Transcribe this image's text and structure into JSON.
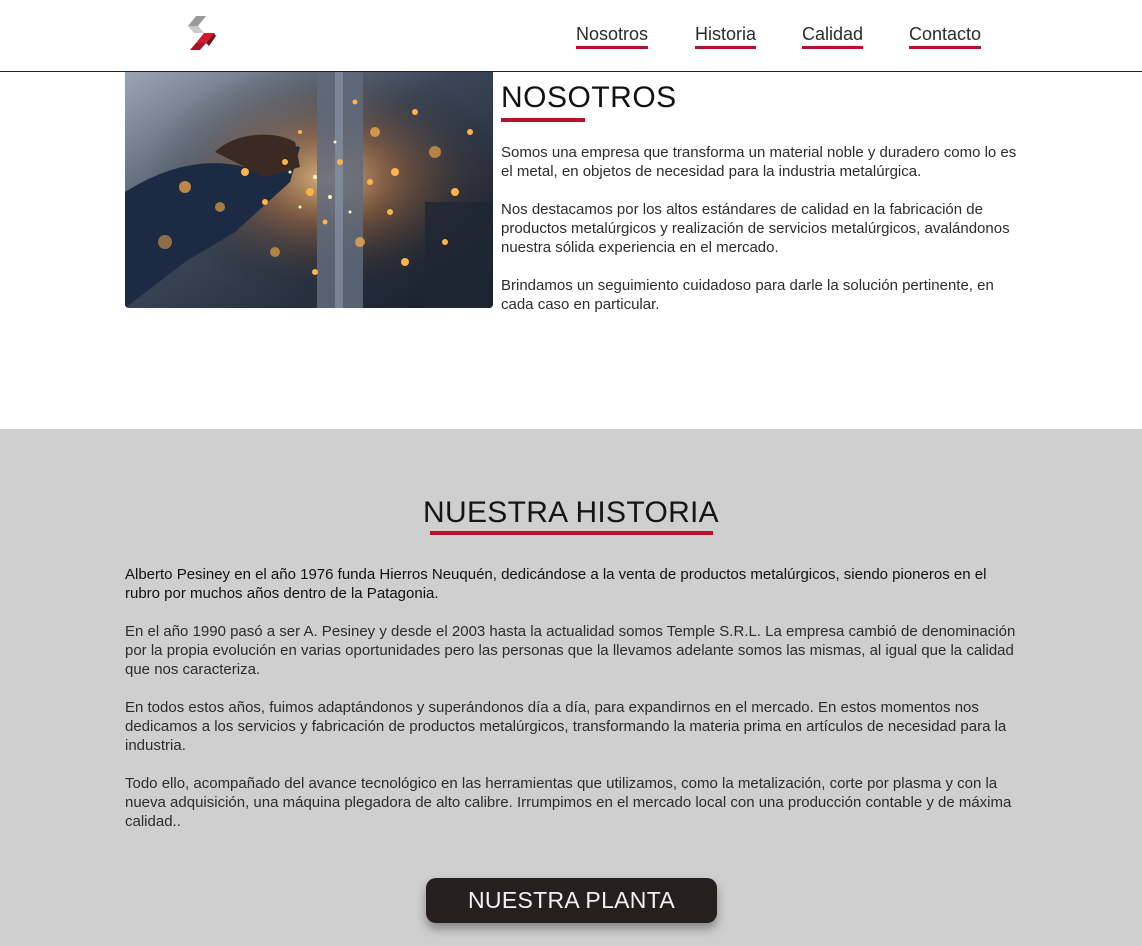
{
  "header": {
    "logo_icon": "temple-logo-icon",
    "nav": [
      {
        "label": "Nosotros"
      },
      {
        "label": "Historia"
      },
      {
        "label": "Calidad"
      },
      {
        "label": "Contacto"
      }
    ]
  },
  "about": {
    "image_icon": "welding-sparks-photo",
    "title": "NOSOTROS",
    "paragraphs": [
      "Somos una empresa que transforma un material noble y duradero como lo es el metal, en objetos de necesidad para la industria metalúrgica.",
      "Nos destacamos por los altos estándares de calidad en la fabricación de productos metalúrgicos y realización de servicios metalúrgicos, avalándonos nuestra sólida experiencia en el mercado.",
      "Brindamos un seguimiento cuidadoso para darle la solución pertinente, en cada caso en particular."
    ]
  },
  "history": {
    "title": "NUESTRA HISTORIA",
    "paragraphs": [
      "Alberto Pesiney en el año 1976 funda Hierros Neuquén, dedicándose a la venta de productos metalúrgicos, siendo pioneros en el rubro por muchos años dentro de la Patagonia.",
      "En el año 1990 pasó a ser A. Pesiney y desde el 2003 hasta la actualidad somos Temple S.R.L. La empresa cambió de denominación por la propia evolución en varias oportunidades pero las personas que la llevamos adelante somos las mismas, al igual que la calidad que nos caracteriza.",
      "En todos estos años, fuimos adaptándonos y superándonos día a día, para expandirnos en el mercado. En estos momentos nos dedicamos a los servicios y fabricación de productos metalúrgicos, transformando la materia prima en artículos de necesidad para la industria.",
      "Todo ello, acompañado del avance tecnológico en las herramientas que utilizamos, como la metalización, corte por plasma y con la nueva adquisición, una máquina plegadora de alto calibre. Irrumpimos en el mercado local con una producción contable y de máxima calidad.."
    ],
    "button_label": "NUESTRA PLANTA"
  },
  "colors": {
    "accent": "#b0132b",
    "history_bg": "#cfcfcf",
    "button_bg": "#261f1f"
  }
}
